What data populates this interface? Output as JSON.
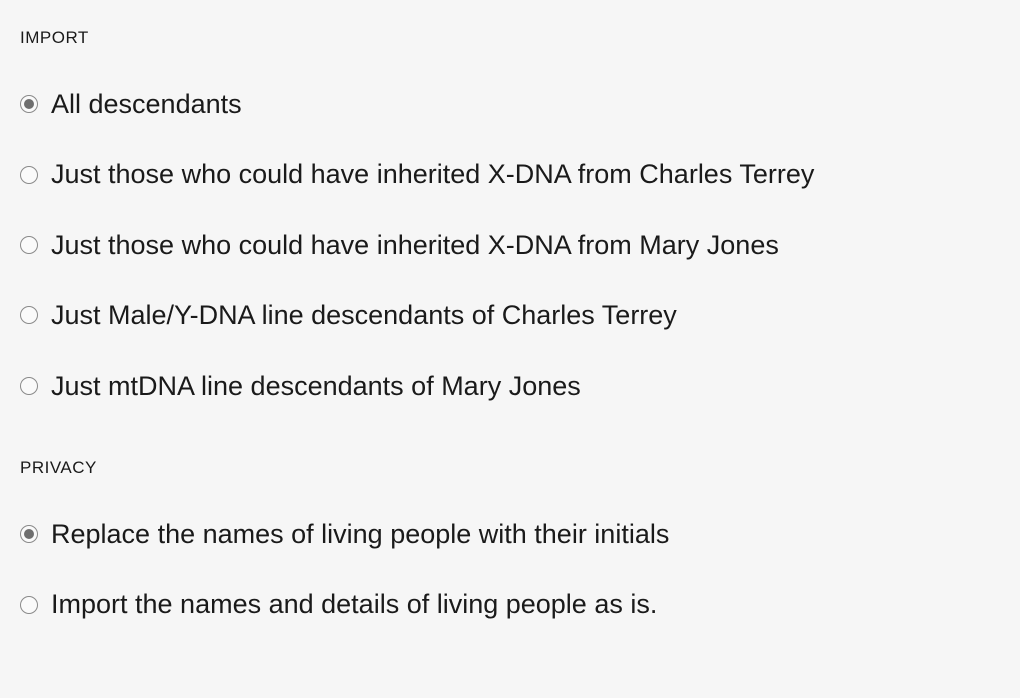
{
  "sections": {
    "import": {
      "header": "IMPORT",
      "options": [
        {
          "label": "All descendants",
          "selected": true
        },
        {
          "label": "Just those who could have inherited X-DNA from Charles Terrey",
          "selected": false
        },
        {
          "label": "Just those who could have inherited X-DNA from Mary Jones",
          "selected": false
        },
        {
          "label": "Just Male/Y-DNA line descendants of Charles Terrey",
          "selected": false
        },
        {
          "label": "Just mtDNA line descendants of Mary Jones",
          "selected": false
        }
      ]
    },
    "privacy": {
      "header": "PRIVACY",
      "options": [
        {
          "label": "Replace the names of living people with their initials",
          "selected": true
        },
        {
          "label": "Import the names and details of living people as is.",
          "selected": false
        }
      ]
    }
  }
}
